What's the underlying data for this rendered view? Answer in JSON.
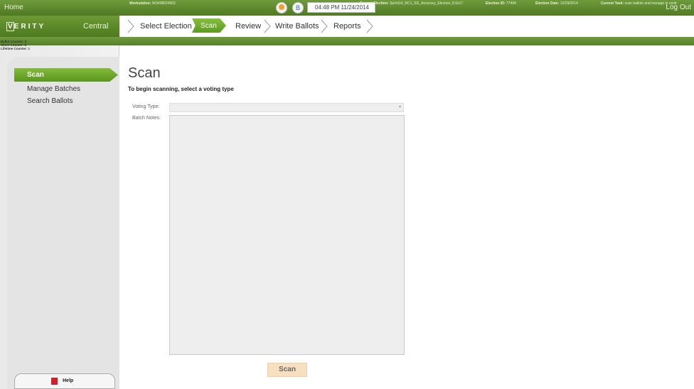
{
  "header": {
    "home": "Home",
    "datetime": "04:48 PM 11/24/2014",
    "logout": "Log Out"
  },
  "brand": {
    "logo_letter": "V",
    "logo_rest": "ERITY",
    "product": "Central"
  },
  "breadcrumbs": [
    {
      "label": "Select Election",
      "active": false
    },
    {
      "label": "Scan",
      "active": true
    },
    {
      "label": "Review",
      "active": false
    },
    {
      "label": "Write Ballots",
      "active": false
    },
    {
      "label": "Reports",
      "active": false
    }
  ],
  "infobar": {
    "workstation_label": "Workstation:",
    "workstation": "WS498024502",
    "current_election_label": "Current Election:",
    "current_election": "Sprint14_RC1_SG_Accuracy_Election_8.5x17",
    "election_id_label": "Election ID:",
    "election_id": "77494",
    "election_date_label": "Election Date:",
    "election_date": "12/29/2014",
    "current_task_label": "Current Task:",
    "current_task": "scan ballots and manage in centr"
  },
  "counters": {
    "ballot": "Ballot Counter: 8",
    "sheet": "Sheet Counter: 8",
    "lifetime": "Lifetime Counter: 1"
  },
  "sidebar": {
    "items": [
      {
        "label": "Scan",
        "active": true
      },
      {
        "label": "Manage Batches",
        "active": false
      },
      {
        "label": "Search Ballots",
        "active": false
      }
    ],
    "help": "Help"
  },
  "main": {
    "title": "Scan",
    "subtitle": "To begin scanning, select a voting type",
    "voting_type_label": "Voting Type:",
    "voting_type_value": "",
    "batch_notes_label": "Batch Notes:",
    "batch_notes_value": "",
    "scan_button": "Scan"
  },
  "colors": {
    "brand_green": "#5d8f2a",
    "active_green": "#6faa2b",
    "scan_button_bg": "#f7dfbf"
  }
}
